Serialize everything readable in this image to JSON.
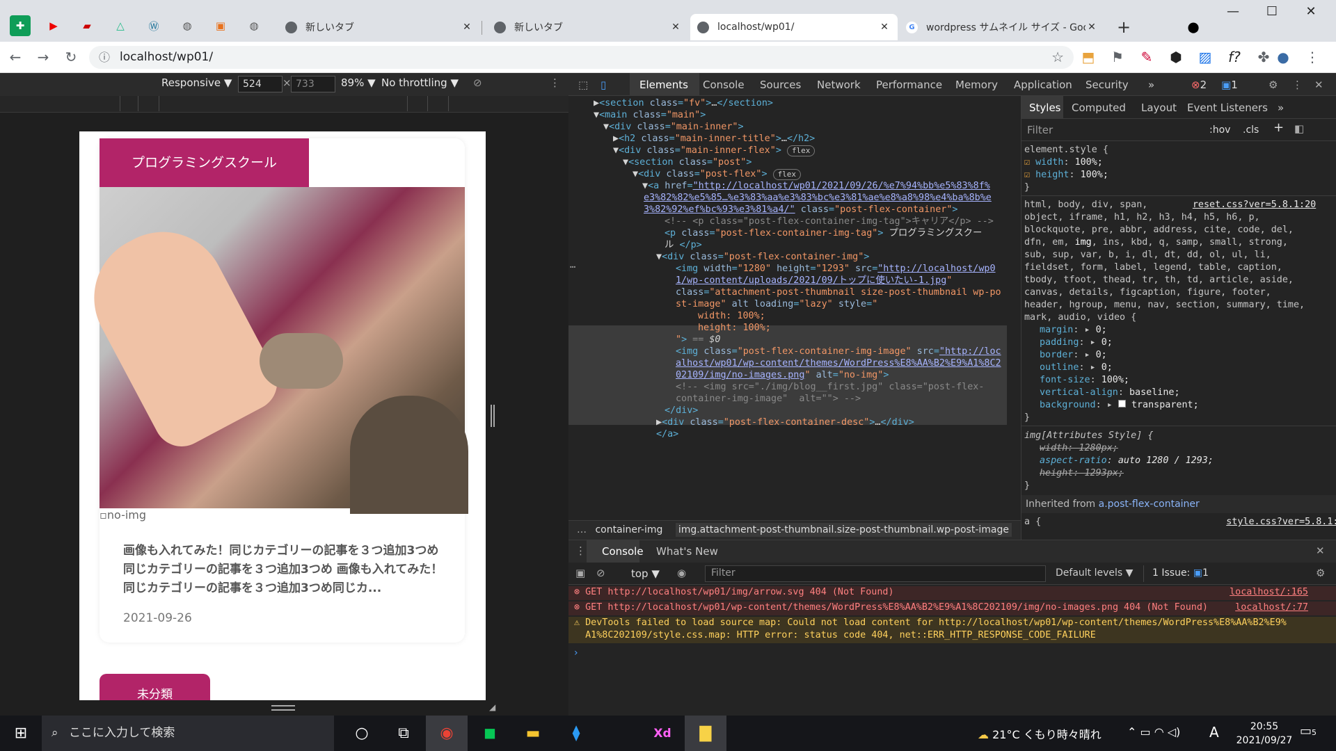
{
  "tabs": [
    {
      "title": "新しいタブ"
    },
    {
      "title": "新しいタブ"
    },
    {
      "title": "localhost/wp01/"
    },
    {
      "title": "wordpress サムネイル サイズ - Goo"
    }
  ],
  "address": "localhost/wp01/",
  "device": {
    "mode": "Responsive",
    "width": "524",
    "height": "733",
    "zoom": "89%",
    "throttle": "No throttling"
  },
  "page": {
    "category_tag": "プログラミングスクール",
    "noimg_alt": "no-img",
    "excerpt": "画像も入れてみた！同じカテゴリーの記事を３つ追加3つめ同じカテゴリーの記事を３つ追加3つめ 画像も入れてみた！同じカテゴリーの記事を３つ追加3つめ同じカ...",
    "date": "2021-09-26",
    "next_tag": "未分類"
  },
  "devtools": {
    "tabs": [
      "Elements",
      "Console",
      "Sources",
      "Network",
      "Performance",
      "Memory",
      "Application",
      "Security"
    ],
    "more": "»",
    "errors": "2",
    "issues": "1",
    "breadcrumb1": "container-img",
    "breadcrumb2": "img.attachment-post-thumbnail.size-post-thumbnail.wp-post-image",
    "styles_tabs": [
      "Styles",
      "Computed",
      "Layout",
      "Event Listeners"
    ],
    "filter": "Filter",
    "hov": ":hov",
    "cls": ".cls",
    "inherited_label": "Inherited from",
    "inherited_from": "a.post-flex-container",
    "drawer_tabs": [
      "Console",
      "What's New"
    ],
    "console_context": "top",
    "levels": "Default levels",
    "issues_label": "1 Issue:",
    "messages": [
      {
        "type": "error",
        "text": "GET http://localhost/wp01/img/arrow.svg 404 (Not Found)",
        "src": "localhost/:165"
      },
      {
        "type": "error",
        "text": "GET http://localhost/wp01/wp-content/themes/WordPress%E8%AA%B2%E9%A1%8C202109/img/no-images.png 404 (Not Found)",
        "src": "localhost/:77"
      },
      {
        "type": "warn",
        "text": "DevTools failed to load source map: Could not load content for http://localhost/wp01/wp-content/themes/WordPress%E8%AA%B2%E9%\nA1%8C202109/style.css.map: HTTP error: status code 404, net::ERR_HTTP_RESPONSE_CODE_FAILURE",
        "src": ""
      }
    ]
  },
  "taskbar": {
    "search": "ここに入力して検索",
    "weather": "21°C くもり時々晴れ",
    "ime": "A",
    "time": "20:55",
    "date": "2021/09/27",
    "notifications": "5"
  }
}
